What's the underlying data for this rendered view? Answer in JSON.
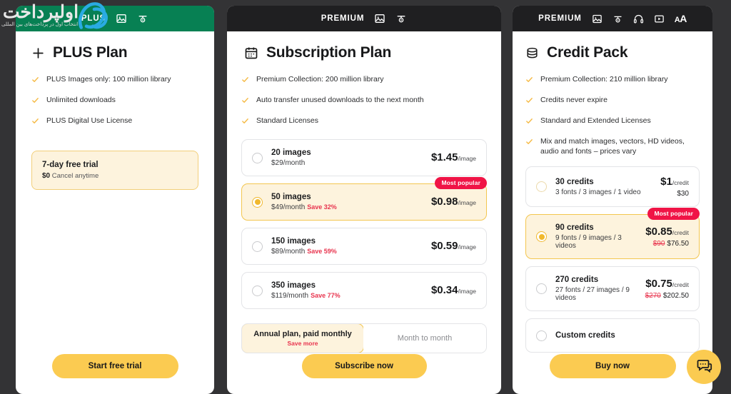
{
  "background_color": "#333335",
  "accent_yellow": "#fbcb51",
  "accent_green": "#078053",
  "accent_red": "#f01446",
  "watermark": {
    "title": "اولپرداخت",
    "subtitle": "انتخاب اول در پرداخت‌های بین المللی",
    "logo_name": "ap-logo"
  },
  "cards": [
    {
      "id": "plus",
      "header": {
        "label": "PLUS",
        "style": "green",
        "icons": [
          "image-icon",
          "vector-icon"
        ]
      },
      "title": "PLUS Plan",
      "title_icon": "plus-icon",
      "features": [
        "PLUS Images only: 100 million library",
        "Unlimited downloads",
        "PLUS Digital Use License"
      ],
      "trial": {
        "title": "7-day free trial",
        "price": "$0",
        "note": "Cancel anytime"
      },
      "cta": "Start free trial"
    },
    {
      "id": "subscription",
      "header": {
        "label": "PREMIUM",
        "style": "dark",
        "icons": [
          "image-icon",
          "vector-icon"
        ]
      },
      "title": "Subscription Plan",
      "title_icon": "calendar-icon",
      "features": [
        "Premium Collection: 200 million library",
        "Auto transfer unused downloads to the next month",
        "Standard Licenses"
      ],
      "options": [
        {
          "name": "20 images",
          "sub": "$29/month",
          "save": "",
          "price": "$1.45",
          "unit": "/image",
          "total": "",
          "strike": "",
          "selected": false,
          "badge": ""
        },
        {
          "name": "50 images",
          "sub": "$49/month",
          "save": "Save 32%",
          "price": "$0.98",
          "unit": "/image",
          "total": "",
          "strike": "",
          "selected": true,
          "badge": "Most popular"
        },
        {
          "name": "150 images",
          "sub": "$89/month",
          "save": "Save 59%",
          "price": "$0.59",
          "unit": "/image",
          "total": "",
          "strike": "",
          "selected": false,
          "badge": ""
        },
        {
          "name": "350 images",
          "sub": "$119/month",
          "save": "Save 77%",
          "price": "$0.34",
          "unit": "/image",
          "total": "",
          "strike": "",
          "selected": false,
          "badge": ""
        }
      ],
      "billing_toggle": [
        {
          "label": "Annual plan, paid monthly",
          "sub": "Save more",
          "active": true
        },
        {
          "label": "Month to month",
          "sub": "",
          "active": false
        }
      ],
      "cta": "Subscribe now"
    },
    {
      "id": "credit",
      "header": {
        "label": "PREMIUM",
        "style": "dark",
        "icons": [
          "image-icon",
          "vector-icon",
          "audio-icon",
          "video-icon",
          "font-icon"
        ]
      },
      "title": "Credit Pack",
      "title_icon": "coins-icon",
      "features": [
        "Premium Collection: 210 million library",
        "Credits never expire",
        "Standard and Extended Licenses",
        "Mix and match images, vectors, HD videos, audio and fonts – prices vary"
      ],
      "options": [
        {
          "name": "30 credits",
          "sub": "3 fonts / 3 images / 1 video",
          "save": "",
          "price": "$1",
          "unit": "/credit",
          "total": "$30",
          "strike": "",
          "selected": false,
          "badge": ""
        },
        {
          "name": "90 credits",
          "sub": "9 fonts / 9 images / 3 videos",
          "save": "",
          "price": "$0.85",
          "unit": "/credit",
          "total": "$76.50",
          "strike": "$90",
          "selected": true,
          "badge": "Most popular"
        },
        {
          "name": "270 credits",
          "sub": "27 fonts / 27 images / 9 videos",
          "save": "",
          "price": "$0.75",
          "unit": "/credit",
          "total": "$202.50",
          "strike": "$270",
          "selected": false,
          "badge": ""
        },
        {
          "name": "Custom credits",
          "sub": "",
          "save": "",
          "price": "",
          "unit": "",
          "total": "",
          "strike": "",
          "selected": false,
          "badge": ""
        }
      ],
      "cta": "Buy now"
    }
  ],
  "chat_fab": {
    "icon": "chat-icon"
  }
}
